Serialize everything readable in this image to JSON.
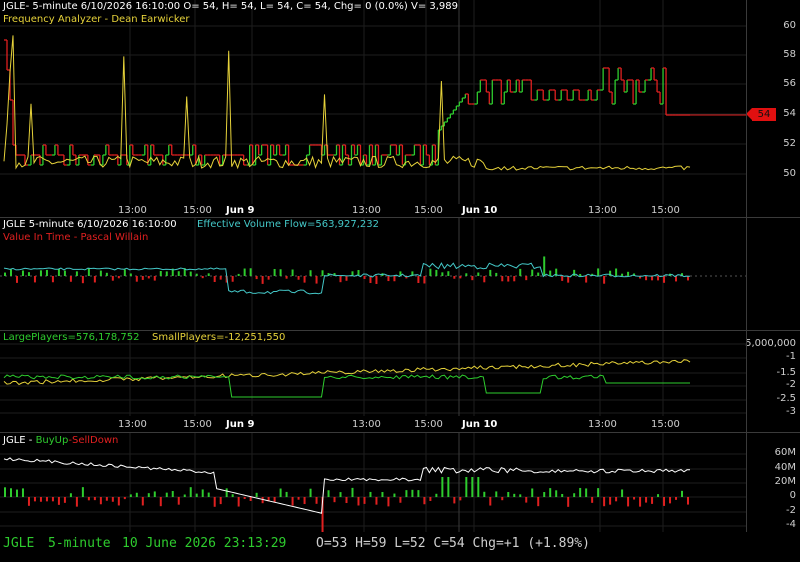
{
  "panel1": {
    "header": "JGLE- 5-minute 6/10/2026 16:10:00 O= 54, H= 54, L= 54, C= 54, Chg= 0 (0.0%) V= 3,989",
    "indicator": "Frequency Analyzer - Dean Earwicker",
    "y_ticks": [
      "60",
      "58",
      "56",
      "54",
      "52",
      "50"
    ],
    "price_tag": "54"
  },
  "time_axis1": [
    "13:00",
    "15:00",
    "Jun 9",
    "13:00",
    "15:00",
    "Jun 10",
    "13:00",
    "15:00"
  ],
  "panel2": {
    "header": "JGLE 5-minute  6/10/2026 16:10:00",
    "evf": "Effective Volume Flow=563,927,232",
    "indicator": "Value In Time - Pascal Willain"
  },
  "panel3": {
    "large": "LargePlayers=576,178,752",
    "small": "SmallPlayers=-12,251,550",
    "y_ticks": [
      "5,000,000",
      "-1",
      "-1.5",
      "-2",
      "-2.5",
      "-3"
    ]
  },
  "time_axis2": [
    "13:00",
    "15:00",
    "Jun 9",
    "13:00",
    "15:00",
    "Jun 10",
    "13:00",
    "15:00"
  ],
  "panel4": {
    "name": "JGLE",
    "sep": " - ",
    "buy": "BuyUp",
    "sep2": "-",
    "sell": "SellDown",
    "y_ticks": [
      "60M",
      "40M",
      "20M",
      "0",
      "-2",
      "-4"
    ]
  },
  "status": {
    "symbol": "JGLE",
    "interval": "5-minute",
    "datetime": "10 June 2026 23:13:29",
    "ohlc": "O=53  H=59  L=52  C=54  Chg=+1 (+1.89%)"
  },
  "colors": {
    "green": "#2ecc2e",
    "red": "#e02020",
    "yellow": "#e6d23a",
    "cyan": "#44c8c8",
    "white": "#ffffff"
  }
}
